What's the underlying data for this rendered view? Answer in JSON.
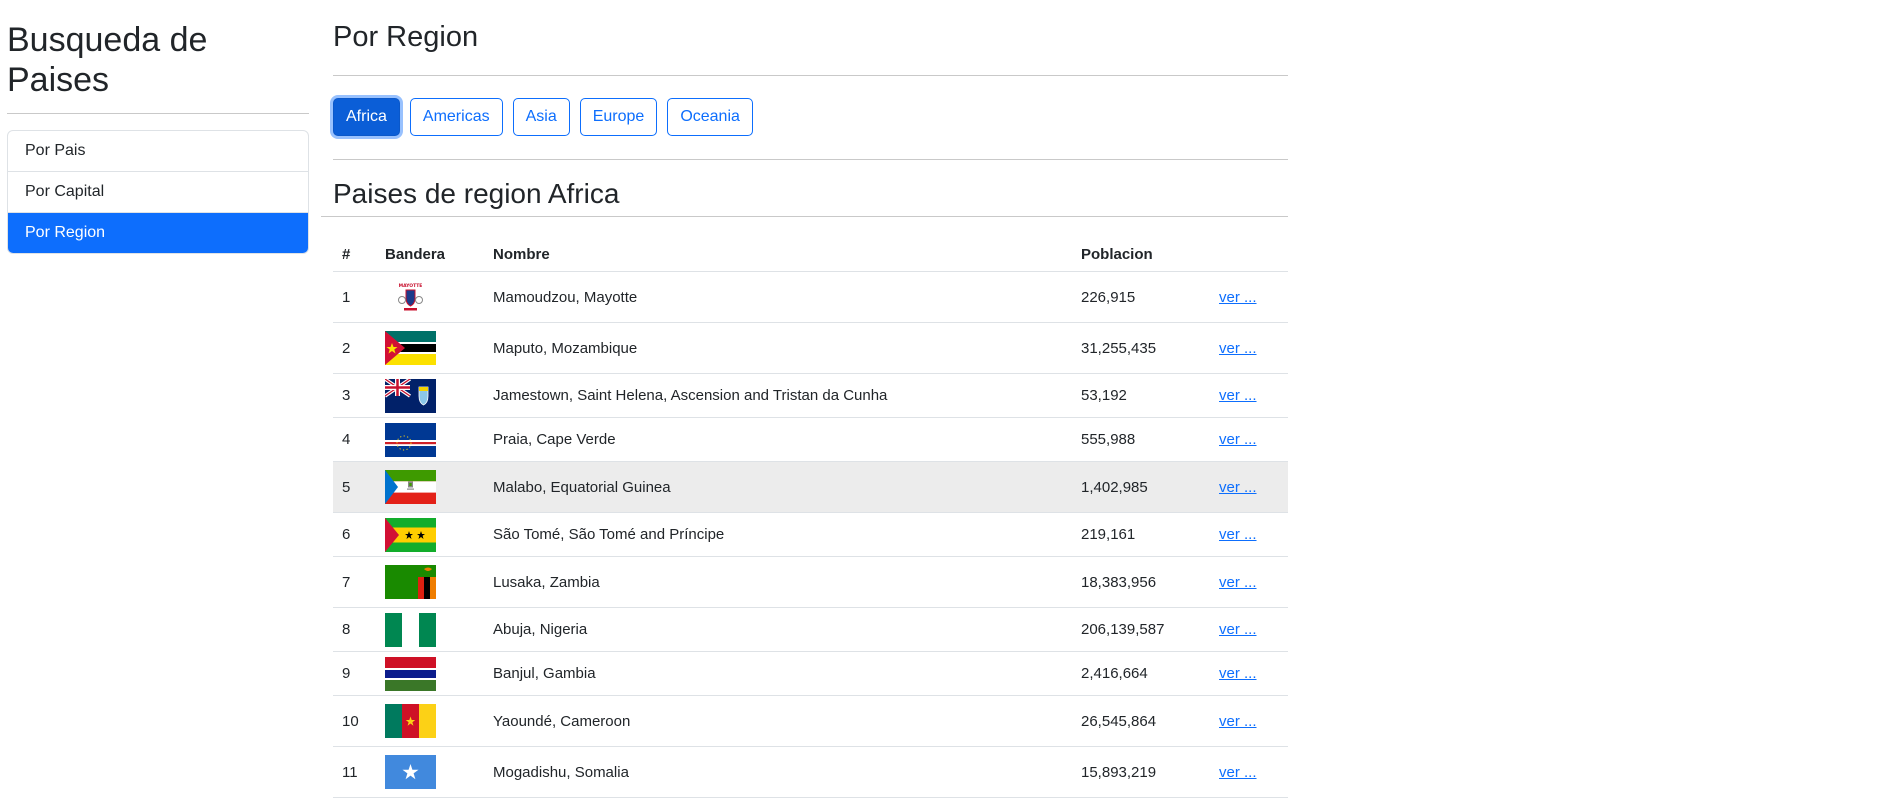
{
  "sidebar": {
    "title": "Busqueda de Paises",
    "items": [
      {
        "label": "Por Pais"
      },
      {
        "label": "Por Capital"
      },
      {
        "label": "Por Region"
      }
    ]
  },
  "main": {
    "title": "Por Region",
    "region_buttons": [
      {
        "label": "Africa"
      },
      {
        "label": "Americas"
      },
      {
        "label": "Asia"
      },
      {
        "label": "Europe"
      },
      {
        "label": "Oceania"
      }
    ],
    "subtitle": "Paises de region Africa",
    "table": {
      "headers": [
        "#",
        "Bandera",
        "Nombre",
        "Poblacion"
      ],
      "link_label": "ver ...",
      "rows": [
        {
          "num": "1",
          "flag": "mayotte-flag",
          "name": "Mamoudzou, Mayotte",
          "pop": "226,915"
        },
        {
          "num": "2",
          "flag": "mozambique-flag",
          "name": "Maputo, Mozambique",
          "pop": "31,255,435"
        },
        {
          "num": "3",
          "flag": "saint-helena-flag",
          "name": "Jamestown, Saint Helena, Ascension and Tristan da Cunha",
          "pop": "53,192"
        },
        {
          "num": "4",
          "flag": "cape-verde-flag",
          "name": "Praia, Cape Verde",
          "pop": "555,988"
        },
        {
          "num": "5",
          "flag": "equatorial-guinea-flag",
          "name": "Malabo, Equatorial Guinea",
          "pop": "1,402,985"
        },
        {
          "num": "6",
          "flag": "sao-tome-flag",
          "name": "São Tomé, São Tomé and Príncipe",
          "pop": "219,161"
        },
        {
          "num": "7",
          "flag": "zambia-flag",
          "name": "Lusaka, Zambia",
          "pop": "18,383,956"
        },
        {
          "num": "8",
          "flag": "nigeria-flag",
          "name": "Abuja, Nigeria",
          "pop": "206,139,587"
        },
        {
          "num": "9",
          "flag": "gambia-flag",
          "name": "Banjul, Gambia",
          "pop": "2,416,664"
        },
        {
          "num": "10",
          "flag": "cameroon-flag",
          "name": "Yaoundé, Cameroon",
          "pop": "26,545,864"
        },
        {
          "num": "11",
          "flag": "somalia-flag",
          "name": "Mogadishu, Somalia",
          "pop": "15,893,219"
        }
      ]
    }
  },
  "colors": {
    "primary": "#0d6efd",
    "row_hover": "#ececec"
  }
}
